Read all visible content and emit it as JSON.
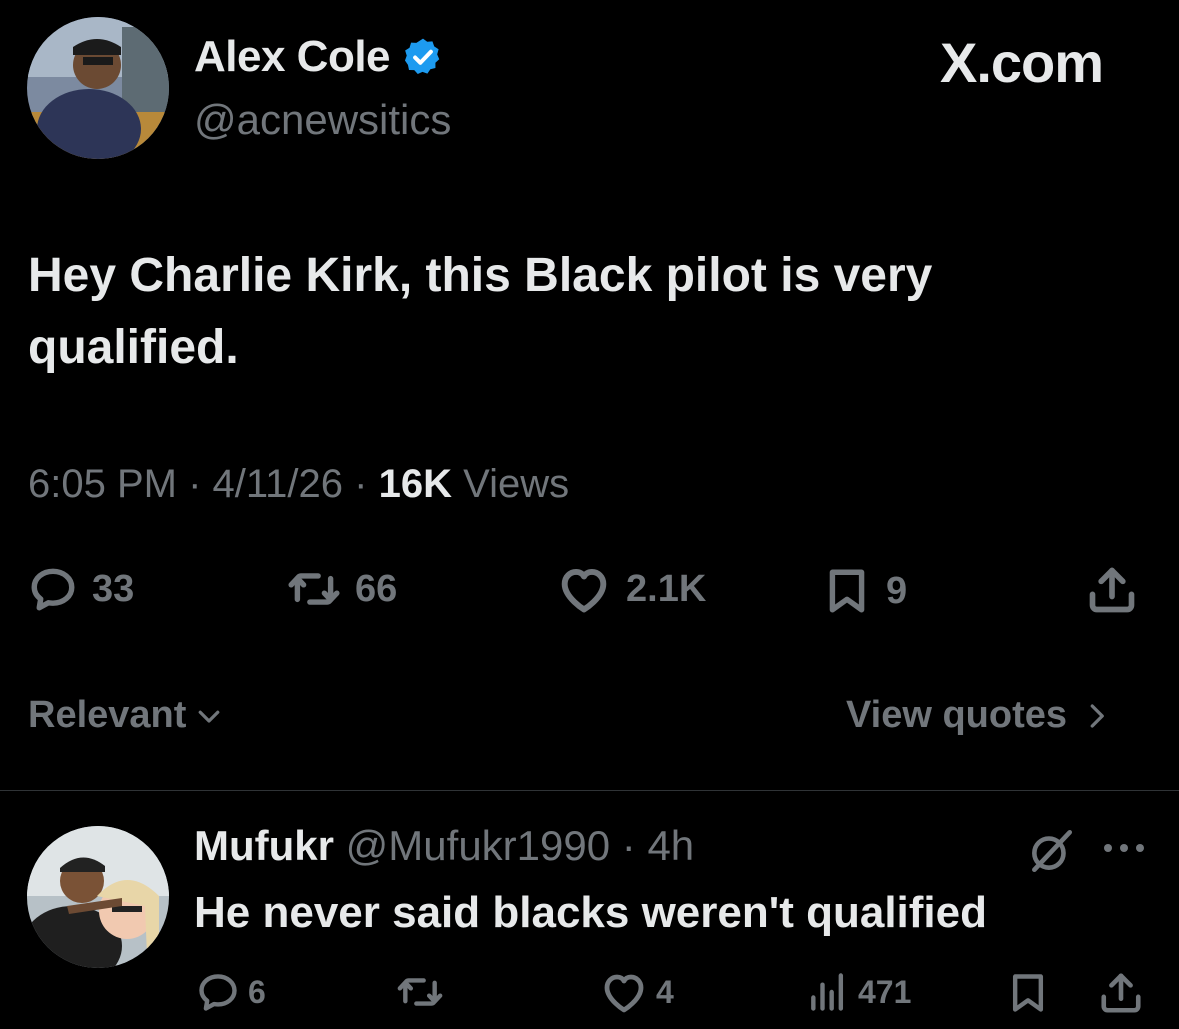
{
  "post": {
    "author_name": "Alex Cole",
    "handle": "@acnewsitics",
    "brand": "X.com",
    "text": "Hey Charlie Kirk, this Black pilot is very qualified.",
    "time": "6:05 PM",
    "date": "4/11/26",
    "views_count": "16K",
    "views_label": "Views",
    "separator": "·",
    "actions": {
      "replies": "33",
      "reposts": "66",
      "likes": "2.1K",
      "bookmarks": "9"
    },
    "verified_badge_color": "#1d9bf0"
  },
  "sort": {
    "label": "Relevant",
    "view_quotes": "View quotes"
  },
  "reply": {
    "name": "Mufukr",
    "handle": "@Mufukr1990",
    "separator": "·",
    "age": "4h",
    "text": "He never said blacks weren't qualified",
    "actions": {
      "replies": "6",
      "likes": "4",
      "views": "471"
    }
  },
  "icons": {
    "reply": "speech-bubble-icon",
    "repost": "repost-arrows-icon",
    "like": "heart-icon",
    "bookmark": "bookmark-icon",
    "share": "share-upload-icon",
    "grok": "grok-slash-circle-icon",
    "more": "more-dots-icon",
    "views": "bar-chart-icon"
  }
}
